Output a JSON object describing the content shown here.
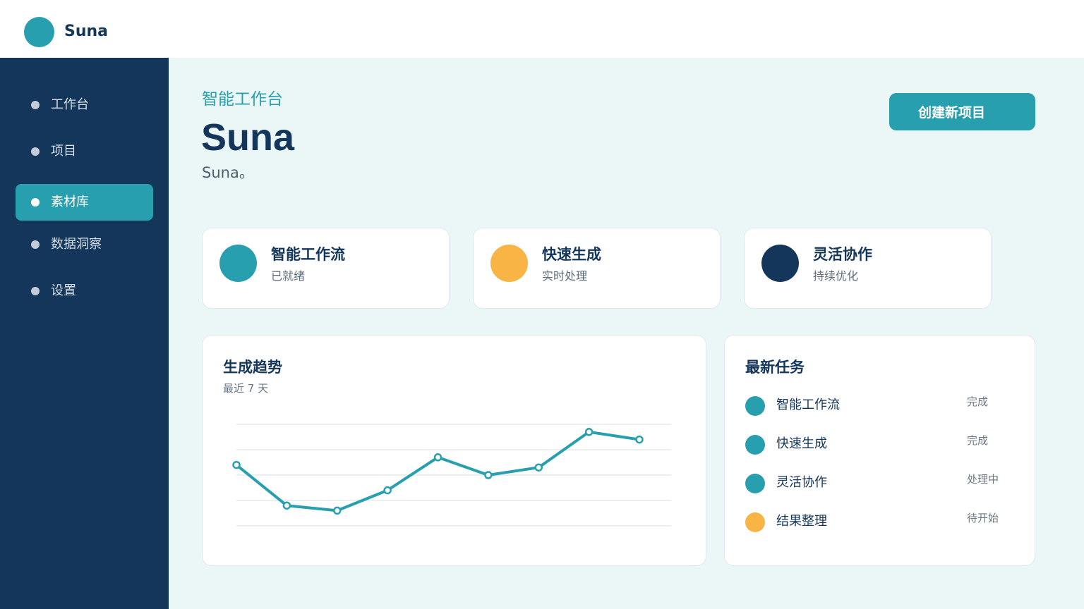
{
  "brand": {
    "name": "Suna",
    "logo_color": "#279fae"
  },
  "sidebar": {
    "items": [
      {
        "label": "工作台",
        "active": false
      },
      {
        "label": "项目",
        "active": false
      },
      {
        "label": "素材库",
        "active": true
      },
      {
        "label": "数据洞察",
        "active": false
      },
      {
        "label": "设置",
        "active": false
      }
    ]
  },
  "header": {
    "kicker": "智能工作台",
    "title": "Suna",
    "subtitle": "Suna。",
    "create_label": "创建新项目"
  },
  "stats": [
    {
      "title": "智能工作流",
      "subtitle": "已就绪",
      "color": "#279fae"
    },
    {
      "title": "快速生成",
      "subtitle": "实时处理",
      "color": "#f8b444"
    },
    {
      "title": "灵活协作",
      "subtitle": "持续优化",
      "color": "#14365a"
    }
  ],
  "trend": {
    "title": "生成趋势",
    "subtitle": "最近 7 天"
  },
  "chart_data": {
    "type": "line",
    "title": "生成趋势",
    "subtitle": "最近 7 天",
    "xlabel": "",
    "ylabel": "",
    "ylim": [
      0,
      4
    ],
    "grid": true,
    "x": [
      1,
      2,
      3,
      4,
      5,
      6,
      7,
      8,
      9
    ],
    "series": [
      {
        "values": [
          2.4,
          0.8,
          0.6,
          1.4,
          2.7,
          2.0,
          2.3,
          3.7,
          3.4
        ],
        "color": "#279fae"
      }
    ]
  },
  "tasks": {
    "title": "最新任务",
    "items": [
      {
        "name": "智能工作流",
        "status": "完成",
        "color": "#279fae"
      },
      {
        "name": "快速生成",
        "status": "完成",
        "color": "#279fae"
      },
      {
        "name": "灵活协作",
        "status": "处理中",
        "color": "#279fae"
      },
      {
        "name": "结果整理",
        "status": "待开始",
        "color": "#f8b444"
      }
    ]
  }
}
